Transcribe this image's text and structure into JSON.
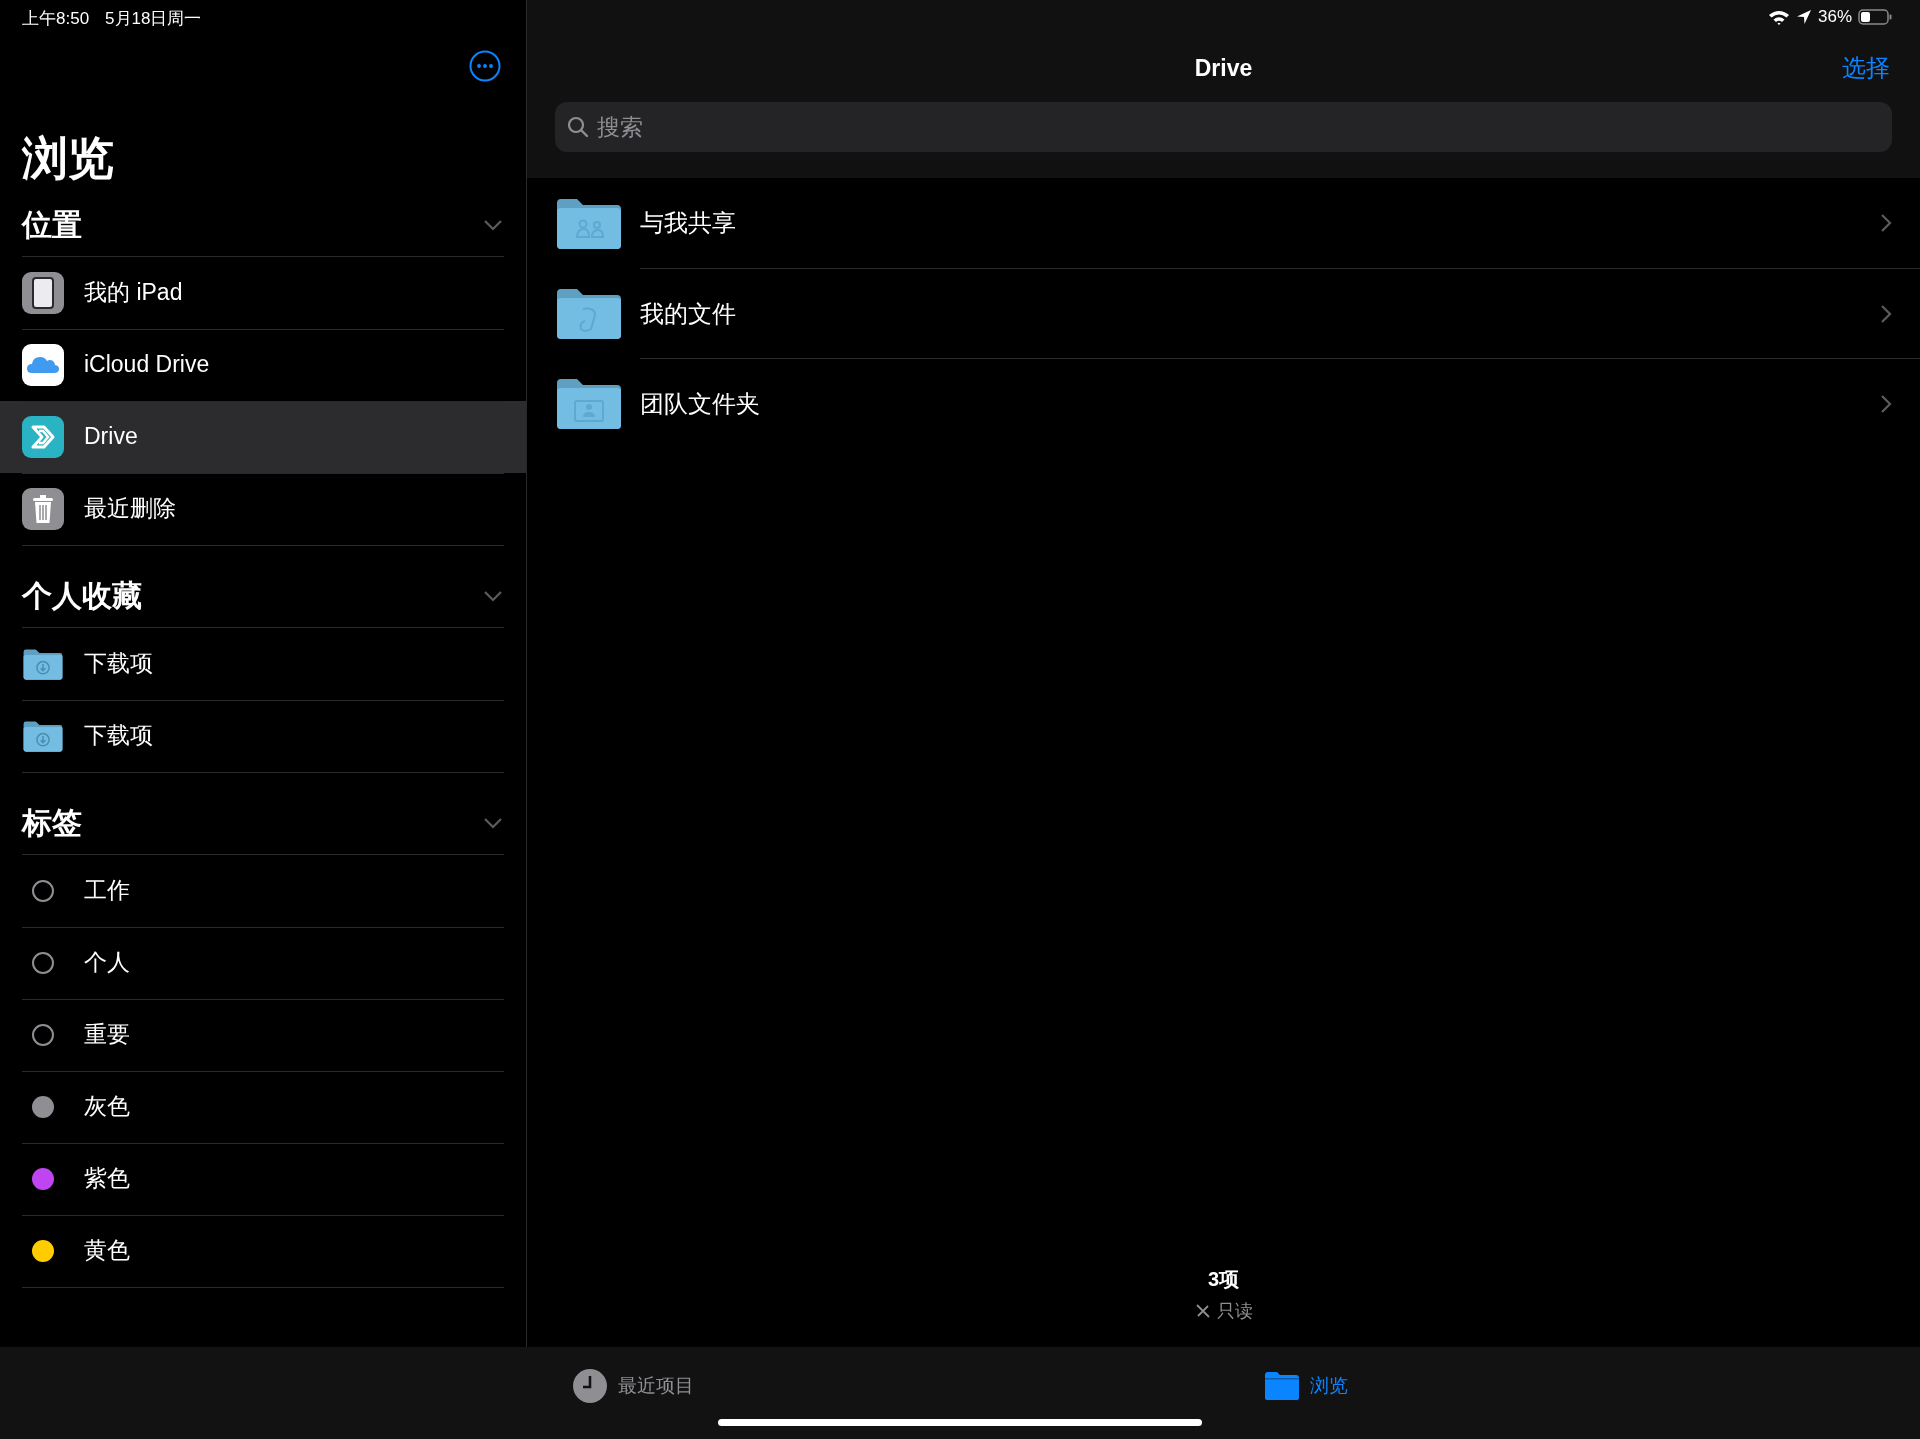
{
  "status_bar": {
    "time": "上午8:50",
    "date": "5月18日周一",
    "battery": "36%"
  },
  "sidebar": {
    "title": "浏览",
    "sections": [
      {
        "title": "位置",
        "expanded": true,
        "items": [
          {
            "label": "我的 iPad",
            "kind": "ipad",
            "selected": false
          },
          {
            "label": "iCloud Drive",
            "kind": "cloud",
            "selected": false
          },
          {
            "label": "Drive",
            "kind": "drive-app",
            "selected": true
          },
          {
            "label": "最近删除",
            "kind": "trash",
            "selected": false
          }
        ]
      },
      {
        "title": "个人收藏",
        "expanded": true,
        "items": [
          {
            "label": "下载项",
            "kind": "downloads-folder",
            "selected": false
          },
          {
            "label": "下载项",
            "kind": "downloads-folder",
            "selected": false
          }
        ]
      },
      {
        "title": "标签",
        "expanded": true,
        "items": [
          {
            "label": "工作",
            "kind": "tag",
            "selected": false
          },
          {
            "label": "个人",
            "kind": "tag",
            "selected": false
          },
          {
            "label": "重要",
            "kind": "tag",
            "selected": false
          },
          {
            "label": "灰色",
            "kind": "tag",
            "color": "#8e8e93",
            "selected": false
          },
          {
            "label": "紫色",
            "kind": "tag",
            "color": "#bf44f2",
            "selected": false
          },
          {
            "label": "黄色",
            "kind": "tag",
            "color": "#ffcc00",
            "selected": false
          }
        ]
      }
    ]
  },
  "main": {
    "title": "Drive",
    "select_button": "选择",
    "search": {
      "placeholder": "搜索"
    },
    "folders": [
      {
        "name": "与我共享",
        "kind": "shared"
      },
      {
        "name": "我的文件",
        "kind": "document"
      },
      {
        "name": "团队文件夹",
        "kind": "team"
      }
    ],
    "footer": {
      "count": "3项",
      "note": "只读"
    }
  },
  "tab_bar": {
    "tabs": [
      {
        "label": "最近项目",
        "kind": "recents",
        "selected": false
      },
      {
        "label": "浏览",
        "kind": "browse",
        "selected": true
      }
    ]
  }
}
